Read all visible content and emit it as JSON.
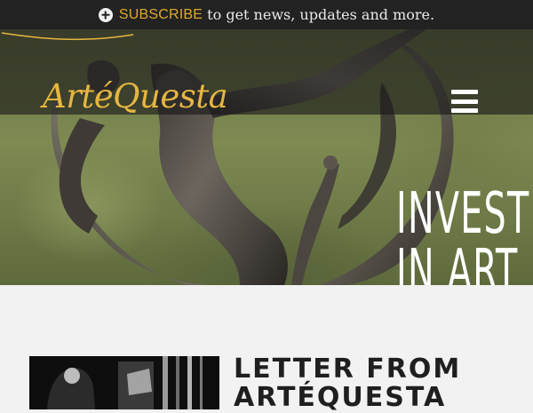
{
  "topbar": {
    "icon": "plus-circle-icon",
    "subscribe_label": "SUBSCRIBE",
    "message": "to get news, updates and more.",
    "link_color": "#e0a92a"
  },
  "header": {
    "logo_text": "ArtéQuesta",
    "logo_color": "#e6b640",
    "menu_icon": "hamburger-menu-icon"
  },
  "hero": {
    "title_line1": "INVEST",
    "title_line2": "IN ART",
    "image": "bronze-sculpture-photo"
  },
  "content": {
    "letter_heading_line1": "LETTER FROM",
    "letter_heading_line2": "ARTÉQUESTA",
    "thumbnail": "black-and-white-photo"
  }
}
